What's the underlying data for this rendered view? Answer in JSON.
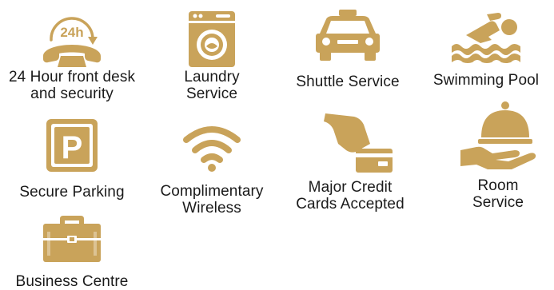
{
  "colors": {
    "icon_gold": "#c9a35a",
    "text": "#1a1a1a",
    "background": "#ffffff"
  },
  "amenities": [
    {
      "icon": "phone-24h-icon",
      "label_line1": "24 Hour front desk",
      "label_line2": "and security",
      "icon_text": "24h"
    },
    {
      "icon": "washing-machine-icon",
      "label_line1": "Laundry",
      "label_line2": "Service"
    },
    {
      "icon": "taxi-icon",
      "label_line1": "Shuttle Service"
    },
    {
      "icon": "swimmer-icon",
      "label_line1": "Swimming Pool"
    },
    {
      "icon": "parking-icon",
      "label_line1": "Secure Parking",
      "icon_text": "P"
    },
    {
      "icon": "wifi-icon",
      "label_line1": "Complimentary",
      "label_line2": "Wireless"
    },
    {
      "icon": "credit-card-hand-icon",
      "label_line1": "Major Credit",
      "label_line2": "Cards Accepted"
    },
    {
      "icon": "room-service-cloche-icon",
      "label_line1": "Room",
      "label_line2": "Service"
    },
    {
      "icon": "briefcase-icon",
      "label_line1": "Business Centre"
    }
  ]
}
